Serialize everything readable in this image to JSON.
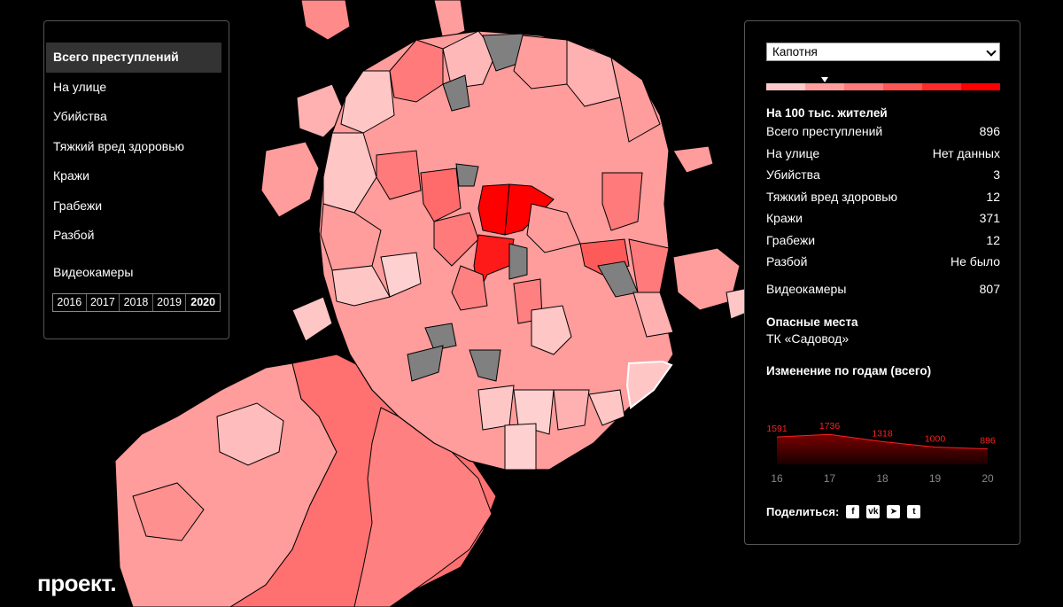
{
  "menu": {
    "items": [
      {
        "label": "Всего преступлений",
        "active": true
      },
      {
        "label": "На улице",
        "active": false
      },
      {
        "label": "Убийства",
        "active": false
      },
      {
        "label": "Тяжкий вред здоровью",
        "active": false
      },
      {
        "label": "Кражи",
        "active": false
      },
      {
        "label": "Грабежи",
        "active": false
      },
      {
        "label": "Разбой",
        "active": false
      }
    ],
    "cameras_label": "Видеокамеры",
    "years": [
      "2016",
      "2017",
      "2018",
      "2019",
      "2020"
    ],
    "active_year": "2020"
  },
  "details": {
    "district": "Капотня",
    "scale_colors": [
      "#ffc9c9",
      "#ff9d9d",
      "#ff7a7a",
      "#ff5555",
      "#ff2a2a",
      "#ff0000"
    ],
    "per_capita_title": "На 100 тыс. жителей",
    "stats": [
      {
        "label": "Всего преступлений",
        "value": "896"
      },
      {
        "label": "На улице",
        "value": "Нет данных"
      },
      {
        "label": "Убийства",
        "value": "3"
      },
      {
        "label": "Тяжкий вред здоровью",
        "value": "12"
      },
      {
        "label": "Кражи",
        "value": "371"
      },
      {
        "label": "Грабежи",
        "value": "12"
      },
      {
        "label": "Разбой",
        "value": "Не было"
      }
    ],
    "cameras": {
      "label": "Видеокамеры",
      "value": "807"
    },
    "dangerous_title": "Опасные места",
    "dangerous_place": "ТК «Садовод»",
    "change_title": "Изменение по годам (всего)",
    "share_label": "Поделиться:",
    "share_icons": [
      "facebook-icon",
      "vk-icon",
      "telegram-icon",
      "twitter-icon"
    ]
  },
  "chart_data": {
    "type": "area",
    "x": [
      "16",
      "17",
      "18",
      "19",
      "20"
    ],
    "values": [
      1591,
      1736,
      1318,
      1000,
      896
    ],
    "color": "#ff2020"
  },
  "logo": "проект."
}
